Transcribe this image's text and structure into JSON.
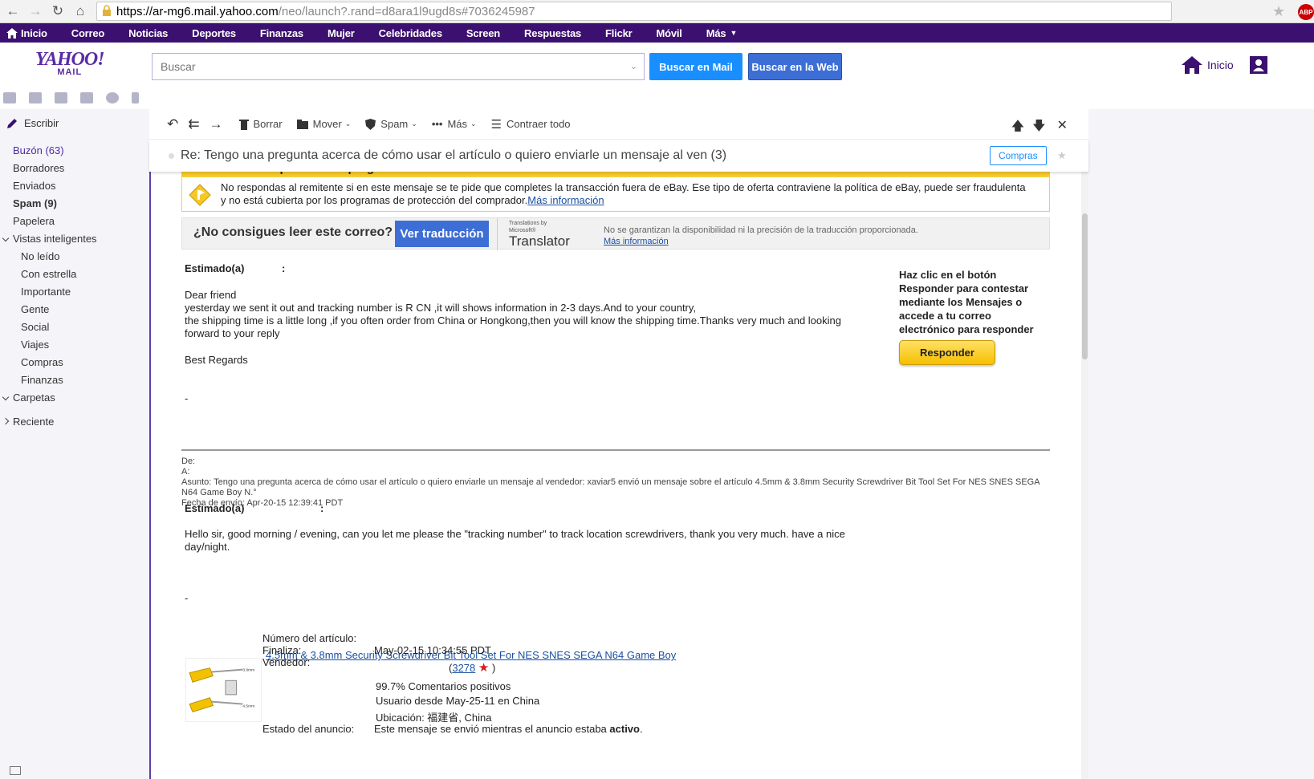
{
  "browser": {
    "url_host": "https://ar-mg6.mail.yahoo.com",
    "url_rest": "/neo/launch?.rand=d8ara1l9ugd8s#7036245987",
    "abp_label": "ABP"
  },
  "topnav": [
    "Inicio",
    "Correo",
    "Noticias",
    "Deportes",
    "Finanzas",
    "Mujer",
    "Celebridades",
    "Screen",
    "Respuestas",
    "Flickr",
    "Móvil",
    "Más"
  ],
  "header": {
    "logo_big": "YAHOO!",
    "logo_small": "MAIL",
    "search_placeholder": "Buscar",
    "btn_mail": "Buscar en Mail",
    "btn_web": "Buscar en la Web",
    "home_label": "Inicio"
  },
  "sidebar": {
    "compose": "Escribir",
    "folders": [
      {
        "label": "Buzón (63)"
      },
      {
        "label": "Borradores"
      },
      {
        "label": "Enviados"
      },
      {
        "label": "Spam (9)"
      },
      {
        "label": "Papelera"
      },
      {
        "label": "Vistas inteligentes"
      },
      {
        "label": "No leído"
      },
      {
        "label": "Con estrella"
      },
      {
        "label": "Importante"
      },
      {
        "label": "Gente"
      },
      {
        "label": "Social"
      },
      {
        "label": "Viajes"
      },
      {
        "label": "Compras"
      },
      {
        "label": "Finanzas"
      },
      {
        "label": "Carpetas"
      },
      {
        "label": "Reciente"
      }
    ]
  },
  "toolbar": {
    "borrar": "Borrar",
    "mover": "Mover",
    "spam": "Spam",
    "mas": "Más",
    "contraer": "Contraer todo"
  },
  "message": {
    "subject": "Re: Tengo una pregunta acerca de cómo usar el artículo o quiero enviarle un mensaje al ven (3)",
    "tag": "Compras",
    "ebay_head": "El vendedor respondió a tu pregunta sobre este artículo",
    "warning_text": "No respondas al remitente si en este mensaje se te pide que completes la transacción fuera de eBay. Ese tipo de oferta contraviene la política de eBay, puede ser fraudulenta y no está cubierta por los programas de protección del comprador.",
    "warning_link": "Más información",
    "trans_question": "¿No consigues leer este correo?",
    "trans_button": "Ver traducción",
    "ms_small1": "Translations by",
    "ms_small2": "Microsoft®",
    "ms_big": "Translator",
    "trans_note": "No se garantizan la disponibilidad ni la precisión de la traducción proporcionada.",
    "trans_link": "Más información",
    "greeting1": "Estimado(a)",
    "greeting_colon": ":",
    "body1": "Dear friend",
    "body2": "yesterday we sent it out and tracking number is R                  CN ,it will shows information in 2-3 days.And to your country,",
    "body3": "the shipping time is a little long ,if you often order from China  or Hongkong,then you will know the shipping time.Thanks very much and looking",
    "body4": "forward to your reply",
    "regards": "Best Regards",
    "dash": "-",
    "side_note": "Haz clic en el botón Responder para contestar mediante los Mensajes o accede a tu correo electrónico para responder",
    "reply_button": "Responder",
    "meta_de": "De:",
    "meta_a": "A:",
    "meta_asunto": "Asunto: Tengo una pregunta acerca de cómo usar el artículo o quiero enviarle un mensaje al vendedor: xaviar5 envió un mensaje sobre el artículo 4.5mm & 3.8mm Security Screwdriver Bit Tool Set For NES SNES SEGA N64 Game Boy N.°",
    "meta_fecha": "Fecha de envío: Apr-20-15 12:39:41 PDT",
    "greeting2": "Estimado(a)",
    "body5": "Hello sir, good morning / evening, can you let me please the \"tracking number\" to track location screwdrivers, thank you very much. have a nice",
    "body6": "day/night."
  },
  "item": {
    "title": "4.5mm & 3.8mm Security Screwdriver Bit Tool Set For NES SNES SEGA N64 Game Boy",
    "img_label1": "3.8mm",
    "img_label2": "4.5mm",
    "lbl_numero": "Número del artículo:",
    "lbl_finaliza": "Finaliza:",
    "val_finaliza": "May-02-15 10:34:55 PDT",
    "lbl_vendedor": "Vendedor:",
    "seller_open": "(",
    "seller_score": "3278",
    "seller_close": ")",
    "feedback": "99.7% Comentarios positivos",
    "since": "Usuario desde May-25-11 en China",
    "location": "Ubicación: 福建省, China",
    "lbl_estado": "Estado del anuncio:",
    "val_estado": "Este mensaje se envió mientras el anuncio estaba",
    "val_estado_bold": "activo",
    "val_estado_end": "."
  },
  "colors": {
    "nav_bg": "#3b1070",
    "brand": "#5b2ba3",
    "primary": "#198fff",
    "ebay_yellow": "#f7c928"
  }
}
